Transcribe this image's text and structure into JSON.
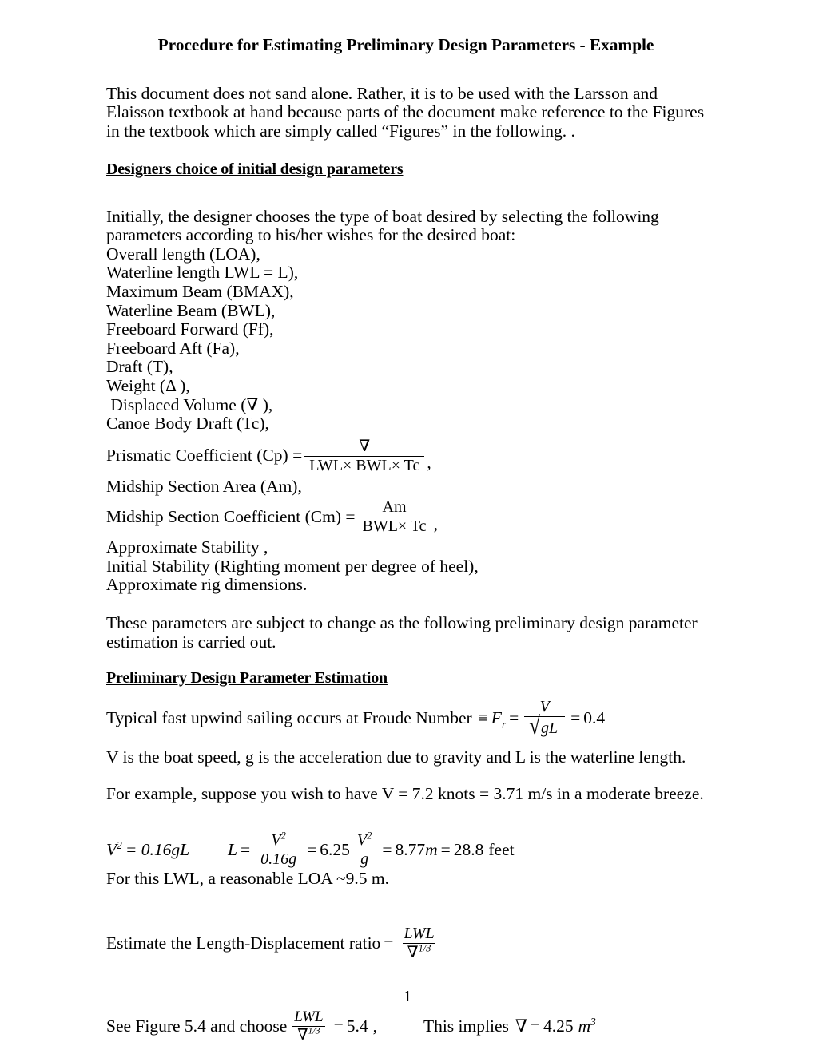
{
  "document": {
    "title": "Procedure for Estimating Preliminary Design Parameters - Example",
    "page_number": "1"
  },
  "intro": {
    "paragraph": "This document does not sand alone. Rather, it is to be used with the Larsson and Elaisson textbook at hand because parts of the document make reference to the Figures in the textbook which are simply called “Figures” in the following. ."
  },
  "section_designers": {
    "heading": "Designers choice of initial design parameters",
    "intro": "Initially, the designer chooses the type of boat desired by selecting the following parameters according to his/her wishes for the desired boat:",
    "parameters": [
      "Overall length (LOA),",
      "Waterline length LWL = L),",
      "Maximum Beam (BMAX),",
      "Waterline Beam (BWL),",
      "Freeboard Forward (Ff),",
      "Freeboard Aft (Fa),",
      "Draft (T),",
      "Weight (Δ ),",
      " Displaced Volume (∇ ),",
      "Canoe Body Draft (Tc),"
    ],
    "prismatic": {
      "label": "Prismatic Coefficient (Cp) =",
      "numerator": "∇",
      "denominator": "LWL× BWL× Tc",
      "trailing": ","
    },
    "midship_area": "Midship Section Area (Am),",
    "midship_coeff": {
      "label": "Midship Section Coefficient (Cm) =",
      "numerator": "Am",
      "denominator": "BWL× Tc",
      "trailing": ","
    },
    "tail_parameters": [
      "Approximate Stability ,",
      "Initial Stability (Righting moment per degree of heel),",
      "Approximate rig dimensions."
    ],
    "closing": "These parameters are subject to change as the following preliminary design parameter estimation is carried out."
  },
  "section_estimation": {
    "heading": "Preliminary Design Parameter Estimation",
    "froude": {
      "lead": "Typical fast upwind sailing occurs at  Froude Number",
      "equiv": "≡",
      "symbol": "F",
      "subscript": "r",
      "equals": "=",
      "numerator": "V",
      "radicand": "gL",
      "result_equals": "=",
      "value": "0.4"
    },
    "variables_note": "V is the boat speed, g is the acceleration due to gravity and L is the waterline length.",
    "example_note": "For example, suppose you wish to have V = 7.2 knots = 3.71 m/s in a moderate breeze.",
    "speed_equation": {
      "lhs_symbol": "V",
      "lhs_exp": "2",
      "lhs_rhs": "= 0.16gL",
      "solve_symbol": "L",
      "solve_equals": "=",
      "frac1_num": "V",
      "frac1_num_exp": "2",
      "frac1_den": "0.16g",
      "mid_equals": "=",
      "coefficient": "6.25",
      "frac2_num": "V",
      "frac2_num_exp": "2",
      "frac2_den": "g",
      "result_equals": "=",
      "result_metric": "8.77",
      "result_metric_unit": "m",
      "result_equals2": "=",
      "result_imperial": "28.8",
      "result_imperial_unit": "feet"
    },
    "loa_note": "For this LWL, a reasonable LOA ~9.5 m.",
    "ratio": {
      "label": "Estimate the Length-Displacement ratio",
      "equals": "=",
      "numerator": "LWL",
      "denominator": "∇",
      "denominator_exp": "1/3"
    },
    "figure_choice": {
      "lead": "See Figure 5.4 and choose",
      "numerator": "LWL",
      "denominator": "∇",
      "denominator_exp": "1/3",
      "equals": "=",
      "value": "5.4",
      "comma": ",",
      "implies_text": "This implies",
      "implies_symbol": "∇",
      "implies_equals": "=",
      "implies_value": "4.25",
      "implies_unit": "m",
      "implies_unit_exp": "3"
    }
  }
}
